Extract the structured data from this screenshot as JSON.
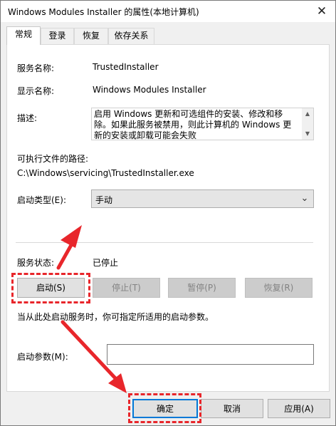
{
  "window": {
    "title": "Windows Modules Installer 的属性(本地计算机)",
    "close_glyph": "✕"
  },
  "tabs": [
    {
      "label": "常规"
    },
    {
      "label": "登录"
    },
    {
      "label": "恢复"
    },
    {
      "label": "依存关系"
    }
  ],
  "general": {
    "service_name_label": "服务名称:",
    "service_name_value": "TrustedInstaller",
    "display_name_label": "显示名称:",
    "display_name_value": "Windows Modules Installer",
    "description_label": "描述:",
    "description_value": "启用 Windows 更新和可选组件的安装、修改和移除。如果此服务被禁用，则此计算机的 Windows 更新的安装或卸载可能会失败",
    "exec_path_label": "可执行文件的路径:",
    "exec_path_value": "C:\\Windows\\servicing\\TrustedInstaller.exe",
    "startup_type_label": "启动类型(E):",
    "startup_type_value": "手动",
    "status_label": "服务状态:",
    "status_value": "已停止",
    "start_button": "启动(S)",
    "stop_button": "停止(T)",
    "pause_button": "暂停(P)",
    "resume_button": "恢复(R)",
    "hint_text": "当从此处启动服务时，你可指定所适用的启动参数。",
    "start_params_label": "启动参数(M):",
    "start_params_value": ""
  },
  "footer": {
    "ok_button": "确定",
    "cancel_button": "取消",
    "apply_button": "应用(A)"
  },
  "icons": {
    "close": "close-icon",
    "scroll_up": "scroll-up-icon",
    "scroll_down": "scroll-down-icon",
    "dropdown": "chevron-down-icon",
    "annotation_arrow": "arrow-annotation-icon"
  },
  "colors": {
    "annotation_red": "#e8262b",
    "focus_blue": "#0078d7",
    "window_bg": "#f0f0f0",
    "panel_bg": "#ffffff"
  }
}
